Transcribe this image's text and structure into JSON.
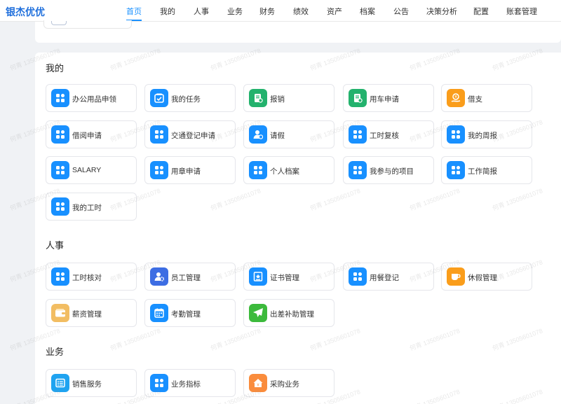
{
  "app": {
    "logo": "银杰优优"
  },
  "nav": {
    "items": [
      "首页",
      "我的",
      "人事",
      "业务",
      "财务",
      "绩效",
      "资产",
      "档案",
      "公告",
      "决策分析",
      "配置",
      "账套管理"
    ],
    "active": "首页"
  },
  "sections": [
    {
      "title": "我的",
      "cards": [
        {
          "label": "办公用品申领",
          "icon": "grid-icon",
          "color": "#1890ff"
        },
        {
          "label": "我的任务",
          "icon": "task-icon",
          "color": "#1890ff"
        },
        {
          "label": "报销",
          "icon": "receipt-icon",
          "color": "#23b26d"
        },
        {
          "label": "用车申请",
          "icon": "receipt-icon",
          "color": "#23b26d"
        },
        {
          "label": "借支",
          "icon": "hand-money-icon",
          "color": "#fa9d1b"
        },
        {
          "label": "借阅申请",
          "icon": "grid-icon",
          "color": "#1890ff"
        },
        {
          "label": "交通登记申请",
          "icon": "grid-icon",
          "color": "#1890ff"
        },
        {
          "label": "请假",
          "icon": "person-clock-icon",
          "color": "#1890ff"
        },
        {
          "label": "工时复核",
          "icon": "grid-icon",
          "color": "#1890ff"
        },
        {
          "label": "我的周报",
          "icon": "grid-icon",
          "color": "#1890ff"
        },
        {
          "label": "SALARY",
          "icon": "grid-icon",
          "color": "#1890ff"
        },
        {
          "label": "用章申请",
          "icon": "grid-icon",
          "color": "#1890ff"
        },
        {
          "label": "个人档案",
          "icon": "grid-icon",
          "color": "#1890ff"
        },
        {
          "label": "我参与的项目",
          "icon": "grid-icon",
          "color": "#1890ff"
        },
        {
          "label": "工作简报",
          "icon": "grid-icon",
          "color": "#1890ff"
        },
        {
          "label": "我的工时",
          "icon": "grid-icon",
          "color": "#1890ff"
        }
      ]
    },
    {
      "title": "人事",
      "cards": [
        {
          "label": "工时核对",
          "icon": "grid-icon",
          "color": "#1890ff"
        },
        {
          "label": "员工管理",
          "icon": "person-gear-icon",
          "color": "#3d6de3"
        },
        {
          "label": "证书管理",
          "icon": "certificate-icon",
          "color": "#1890ff"
        },
        {
          "label": "用餐登记",
          "icon": "grid-icon",
          "color": "#1890ff"
        },
        {
          "label": "休假管理",
          "icon": "coffee-icon",
          "color": "#fa9d1b"
        },
        {
          "label": "薪资管理",
          "icon": "wallet-icon",
          "color": "#f2bd62"
        },
        {
          "label": "考勤管理",
          "icon": "calendar-icon",
          "color": "#1890ff"
        },
        {
          "label": "出差补助管理",
          "icon": "plane-icon",
          "color": "#3cba3c"
        }
      ]
    },
    {
      "title": "业务",
      "cards": [
        {
          "label": "销售服务",
          "icon": "list-icon",
          "color": "#1fa3f0"
        },
        {
          "label": "业务指标",
          "icon": "grid-icon",
          "color": "#1890ff"
        },
        {
          "label": "采购业务",
          "icon": "house-icon",
          "color": "#fa8c3c"
        }
      ]
    }
  ],
  "watermark": "何青 13505601078"
}
